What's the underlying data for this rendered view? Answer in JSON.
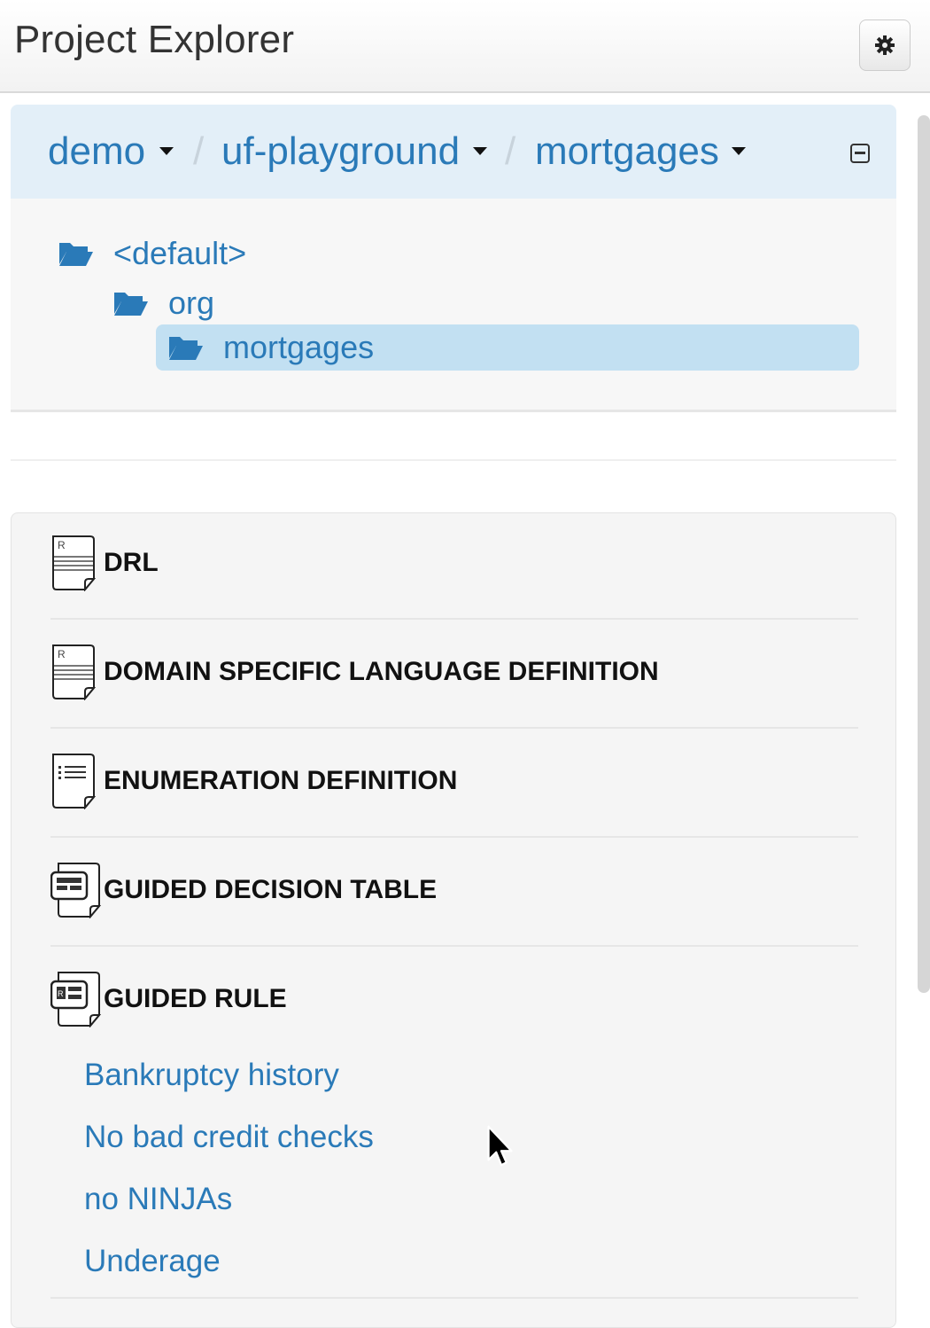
{
  "header": {
    "title": "Project Explorer",
    "gear_icon": "gear-icon"
  },
  "breadcrumb": {
    "items": [
      {
        "label": "demo"
      },
      {
        "label": "uf-playground"
      },
      {
        "label": "mortgages"
      }
    ],
    "separator": "/"
  },
  "tree": {
    "items": [
      {
        "label": "<default>",
        "selected": false
      },
      {
        "label": "org",
        "selected": false
      },
      {
        "label": "mortgages",
        "selected": true
      }
    ]
  },
  "assets": {
    "sections": [
      {
        "label": "DRL",
        "icon": "drl-document-icon"
      },
      {
        "label": "DOMAIN SPECIFIC LANGUAGE DEFINITION",
        "icon": "dsl-document-icon"
      },
      {
        "label": "ENUMERATION DEFINITION",
        "icon": "enumeration-document-icon"
      },
      {
        "label": "GUIDED DECISION TABLE",
        "icon": "decision-table-document-icon"
      },
      {
        "label": "GUIDED RULE",
        "icon": "guided-rule-document-icon",
        "items": [
          "Bankruptcy history",
          "No bad credit checks",
          "no NINJAs",
          "Underage"
        ]
      }
    ]
  },
  "colors": {
    "link": "#2a7ab8",
    "breadcrumb_bg": "#e3eff8",
    "selected_bg": "#c2e0f2"
  }
}
